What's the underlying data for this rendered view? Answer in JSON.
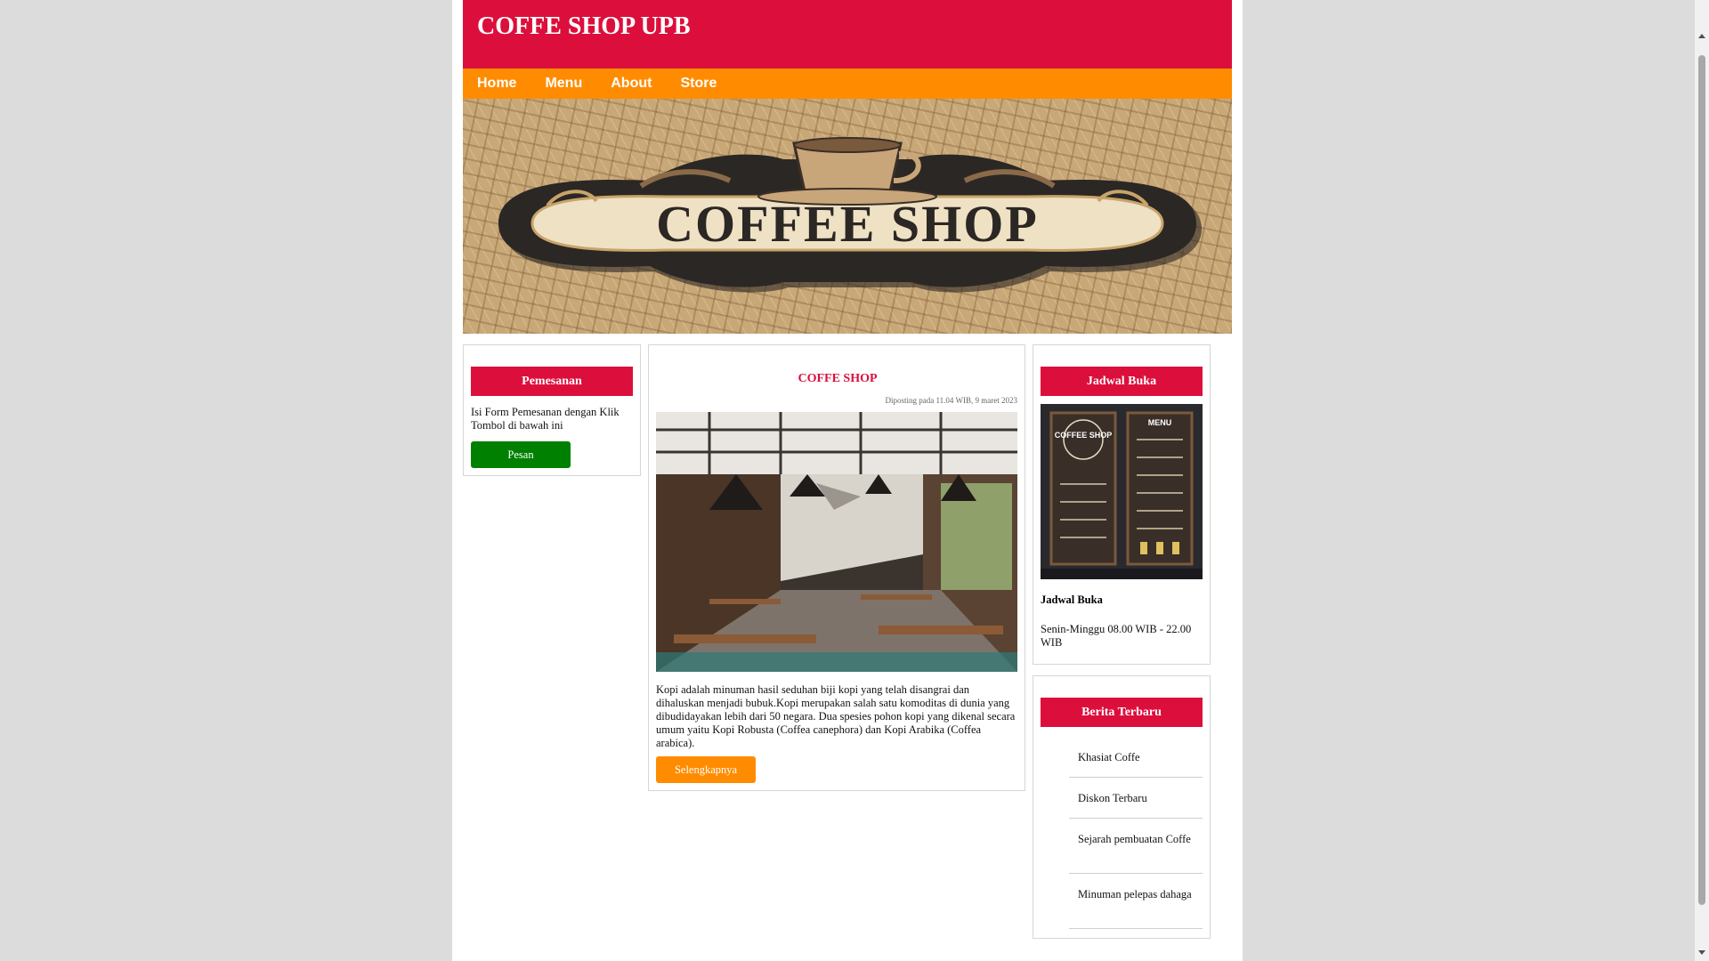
{
  "header": {
    "title": "COFFE SHOP UPB"
  },
  "nav": {
    "items": [
      "Home",
      "Menu",
      "About",
      "Store"
    ]
  },
  "banner": {
    "logo_text": "COFFEE SHOP"
  },
  "order_box": {
    "title": "Pemesanan",
    "description": "Isi Form Pemesanan dengan Klik Tombol di bawah ini",
    "button": "Pesan"
  },
  "article": {
    "title": "COFFE SHOP",
    "meta": "Diposting pada 11.04 WIB, 9 maret 2023",
    "body": "Kopi adalah minuman hasil seduhan biji kopi yang telah disangrai dan dihaluskan menjadi bubuk.Kopi merupakan salah satu komoditas di dunia yang dibudidayakan lebih dari 50 negara. Dua spesies pohon kopi yang dikenal secara umum yaitu Kopi Robusta (Coffea canephora) dan Kopi Arabika (Coffea arabica).",
    "button": "Selengkapnya"
  },
  "schedule_box": {
    "title": "Jadwal Buka",
    "menu_board": {
      "left_title": "COFFEE SHOP",
      "right_title": "MENU"
    },
    "subtitle": "Jadwal Buka",
    "hours": "Senin-Minggu 08.00 WIB - 22.00 WIB"
  },
  "news_box": {
    "title": "Berita Terbaru",
    "items": [
      "Khasiat Coffe",
      "Diskon Terbaru",
      "Sejarah pembuatan Coffe",
      "Minuman pelepas dahaga"
    ]
  },
  "colors": {
    "header": "#dc0f3c",
    "nav": "#ff8c00",
    "button_green": "#008000",
    "button_orange": "#ff8c00"
  }
}
